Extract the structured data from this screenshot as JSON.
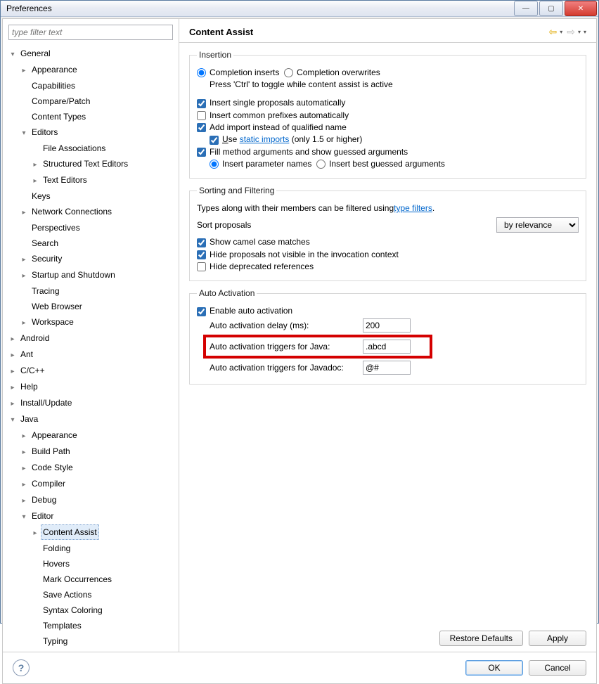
{
  "window": {
    "title": "Preferences"
  },
  "filter": {
    "placeholder": "type filter text"
  },
  "tree": {
    "general": "General",
    "appearance": "Appearance",
    "capabilities": "Capabilities",
    "compare_patch": "Compare/Patch",
    "content_types": "Content Types",
    "editors": "Editors",
    "file_assoc": "File Associations",
    "struct_text": "Structured Text Editors",
    "text_editors": "Text Editors",
    "keys": "Keys",
    "network": "Network Connections",
    "perspectives": "Perspectives",
    "search": "Search",
    "security": "Security",
    "startup": "Startup and Shutdown",
    "tracing": "Tracing",
    "web_browser": "Web Browser",
    "workspace": "Workspace",
    "android": "Android",
    "ant": "Ant",
    "ccpp": "C/C++",
    "help": "Help",
    "install_update": "Install/Update",
    "java": "Java",
    "java_appearance": "Appearance",
    "build_path": "Build Path",
    "code_style": "Code Style",
    "compiler": "Compiler",
    "debug": "Debug",
    "editor": "Editor",
    "content_assist": "Content Assist",
    "folding": "Folding",
    "hovers": "Hovers",
    "mark_occ": "Mark Occurrences",
    "save_actions": "Save Actions",
    "syntax_color": "Syntax Coloring",
    "templates": "Templates",
    "typing": "Typing"
  },
  "header": {
    "title": "Content Assist"
  },
  "insertion": {
    "legend": "Insertion",
    "completion_inserts": "Completion inserts",
    "completion_overwrites": "Completion overwrites",
    "ctrl_hint": "Press 'Ctrl' to toggle while content assist is active",
    "insert_single": "Insert single proposals automatically",
    "insert_common": "Insert common prefixes automatically",
    "add_import": "Add import instead of qualified name",
    "use_pre": "U",
    "use_post": "se ",
    "static_imports": "static imports",
    "static_suffix": " (only 1.5 or higher)",
    "fill_method": "Fill method arguments and show guessed arguments",
    "insert_param": "Insert parameter names",
    "insert_best": "Insert best guessed arguments"
  },
  "sorting": {
    "legend": "Sorting and Filtering",
    "types_text1": "Types along with their members can be filtered using ",
    "type_filters": "type filters",
    "types_text2": ".",
    "sort_label": "Sort proposals",
    "sort_value": "by relevance",
    "show_camel": "Show camel case matches",
    "hide_not_visible": "Hide proposals not visible in the invocation context",
    "hide_deprecated": "Hide deprecated references"
  },
  "auto": {
    "legend": "Auto Activation",
    "enable": "Enable auto activation",
    "delay_label": "Auto activation delay (ms):",
    "delay_value": "200",
    "java_label": "Auto activation triggers for Java:",
    "java_value": ".abcd",
    "javadoc_label": "Auto activation triggers for Javadoc:",
    "javadoc_value": "@#"
  },
  "buttons": {
    "restore": "Restore Defaults",
    "apply": "Apply",
    "ok": "OK",
    "cancel": "Cancel"
  }
}
